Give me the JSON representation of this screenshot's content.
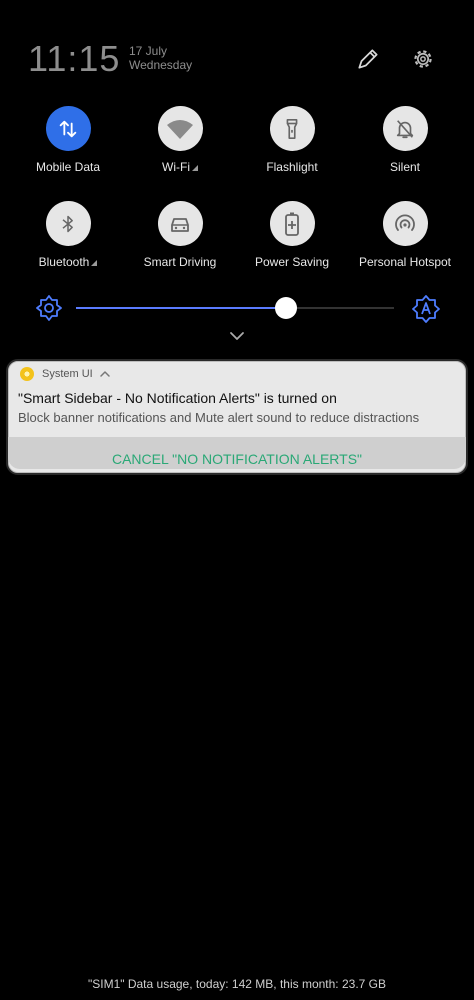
{
  "header": {
    "time": "11:15",
    "date": "17 July",
    "weekday": "Wednesday"
  },
  "quick_tiles": {
    "row1": [
      {
        "label": "Mobile Data",
        "icon": "mobile-data-icon",
        "active": true
      },
      {
        "label": "Wi-Fi",
        "icon": "wifi-icon",
        "active": false
      },
      {
        "label": "Flashlight",
        "icon": "flashlight-icon",
        "active": false
      },
      {
        "label": "Silent",
        "icon": "silent-icon",
        "active": false
      }
    ],
    "row2": [
      {
        "label": "Bluetooth",
        "icon": "bluetooth-icon",
        "active": false
      },
      {
        "label": "Smart Driving",
        "icon": "car-icon",
        "active": false
      },
      {
        "label": "Power Saving",
        "icon": "battery-plus-icon",
        "active": false
      },
      {
        "label": "Personal Hotspot",
        "icon": "hotspot-icon",
        "active": false
      }
    ]
  },
  "brightness": {
    "level": 0.66
  },
  "notification": {
    "app_name": "System UI",
    "title": "\"Smart Sidebar - No Notification Alerts\" is turned on",
    "body": "Block banner notifications and Mute alert sound to reduce distractions",
    "action": "CANCEL \"NO NOTIFICATION ALERTS\""
  },
  "footer": {
    "data_usage": "\"SIM1\" Data usage, today: 142 MB, this month: 23.7 GB"
  },
  "colors": {
    "accent_blue": "#2f6fe8",
    "slider_blue": "#5b7cff",
    "action_green": "#2aa876"
  }
}
